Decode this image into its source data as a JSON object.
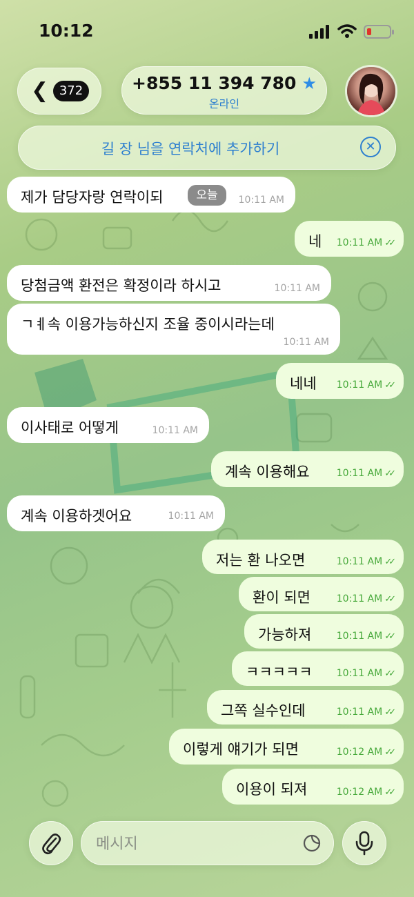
{
  "status_bar": {
    "time": "10:12"
  },
  "header": {
    "unread_count": "372",
    "contact_phone": "+855 11 394 780",
    "status": "온라인"
  },
  "banner": {
    "text": "길 장 님을 연락처에 추가하기"
  },
  "date_pill": "오늘",
  "messages": [
    {
      "dir": "in",
      "text": "제가 담당자랑 연락이되",
      "time": "10:11 AM"
    },
    {
      "dir": "out",
      "text": "네",
      "time": "10:11 AM"
    },
    {
      "dir": "in",
      "text": "당첨금액 환전은 확정이라 하시고",
      "time": "10:11 AM"
    },
    {
      "dir": "in",
      "text": "ㄱㅖ속 이용가능하신지 조율 중이시라는데",
      "time": "10:11 AM"
    },
    {
      "dir": "out",
      "text": "네네",
      "time": "10:11 AM"
    },
    {
      "dir": "in",
      "text": "이사태로 어떻게",
      "time": "10:11 AM"
    },
    {
      "dir": "out",
      "text": "계속 이용해요",
      "time": "10:11 AM"
    },
    {
      "dir": "in",
      "text": "계속 이용하겟어요",
      "time": "10:11 AM"
    },
    {
      "dir": "out",
      "text": "저는 환 나오면",
      "time": "10:11 AM"
    },
    {
      "dir": "out",
      "text": "환이 되면",
      "time": "10:11 AM"
    },
    {
      "dir": "out",
      "text": "가능하져",
      "time": "10:11 AM"
    },
    {
      "dir": "out",
      "text": "ㅋㅋㅋㅋㅋ",
      "time": "10:11 AM"
    },
    {
      "dir": "out",
      "text": "그쪽 실수인데",
      "time": "10:11 AM"
    },
    {
      "dir": "out",
      "text": "이렇게 얘기가 되면",
      "time": "10:12 AM"
    },
    {
      "dir": "out",
      "text": "이용이 되져",
      "time": "10:12 AM"
    }
  ],
  "composer": {
    "placeholder": "메시지"
  },
  "colors": {
    "accent": "#2d7fcf",
    "outgoing_bubble": "#effdde",
    "incoming_bubble": "#ffffff",
    "outgoing_time": "#46a83a",
    "battery_low": "#e0342b"
  },
  "icons": {
    "back": "chevron-left-icon",
    "verified": "star-icon",
    "close": "close-circle-icon",
    "attach": "paperclip-icon",
    "sticker": "sticker-icon",
    "mic": "microphone-icon"
  }
}
